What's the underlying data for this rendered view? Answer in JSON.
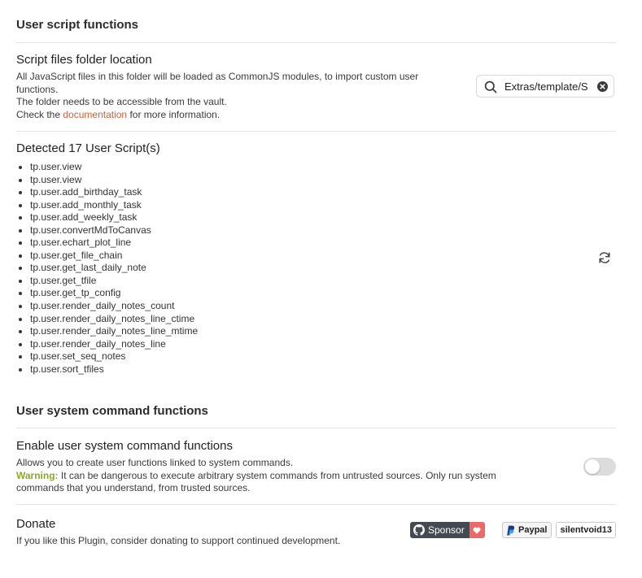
{
  "user_script": {
    "heading": "User script functions",
    "folder_setting": {
      "name": "Script files folder location",
      "desc_line1": "All JavaScript files in this folder will be loaded as CommonJS modules, to import custom user",
      "desc_line2": "functions.",
      "desc_line3": "The folder needs to be accessible from the vault.",
      "desc_check_prefix": "Check the",
      "desc_link": "documentation",
      "desc_check_suffix": "for more information.",
      "search_value": "Extras/template/S",
      "search_icon": "search-icon",
      "clear_icon": "clear-icon"
    },
    "detected": {
      "title": "Detected 17 User Script(s)",
      "scripts": [
        "tp.user.view",
        "tp.user.view",
        "tp.user.add_birthday_task",
        "tp.user.add_monthly_task",
        "tp.user.add_weekly_task",
        "tp.user.convertMdToCanvas",
        "tp.user.echart_plot_line",
        "tp.user.get_file_chain",
        "tp.user.get_last_daily_note",
        "tp.user.get_tfile",
        "tp.user.get_tp_config",
        "tp.user.render_daily_notes_count",
        "tp.user.render_daily_notes_line_ctime",
        "tp.user.render_daily_notes_line_mtime",
        "tp.user.render_daily_notes_line",
        "tp.user.set_seq_notes",
        "tp.user.sort_tfiles"
      ],
      "refresh_icon": "refresh-icon"
    }
  },
  "system_command": {
    "heading": "User system command functions",
    "enable_setting": {
      "name": "Enable user system command functions",
      "desc_line1": "Allows you to create user functions linked to system commands.",
      "warning_label": "Warning:",
      "warning_text_line1": "It can be dangerous to execute arbitrary system commands from untrusted sources. Only run system",
      "warning_text_line2": "commands that you understand, from trusted sources.",
      "toggle_on": false
    }
  },
  "donate": {
    "name": "Donate",
    "desc": "If you like this Plugin, consider donating to support continued development.",
    "sponsor_label": "Sponsor",
    "paypal_label": "Paypal",
    "paypal_user": "silentvoid13"
  },
  "colors": {
    "link": "#c4623a",
    "warning": "#8aa72f",
    "sponsor_dark": "#434a51",
    "sponsor_heart": "#ea6b6b"
  }
}
